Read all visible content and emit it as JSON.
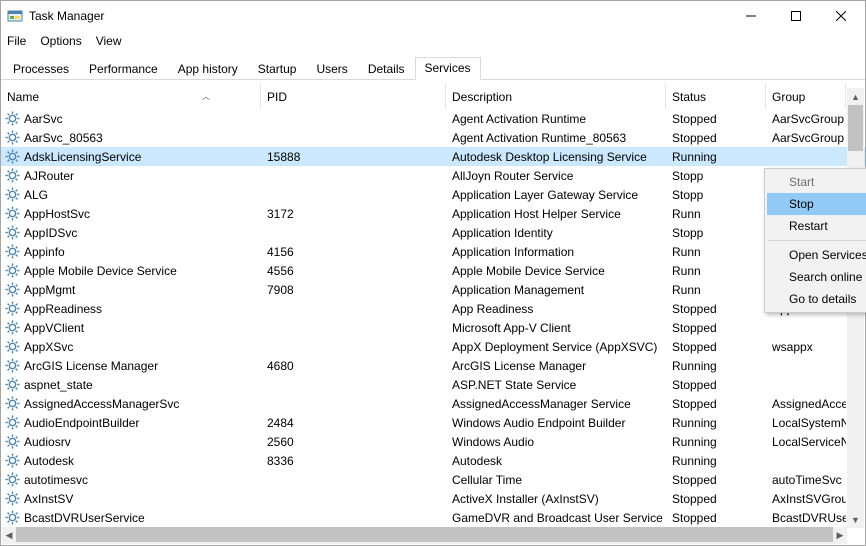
{
  "window": {
    "title": "Task Manager"
  },
  "menus": [
    "File",
    "Options",
    "View"
  ],
  "tabs": [
    {
      "label": "Processes"
    },
    {
      "label": "Performance"
    },
    {
      "label": "App history"
    },
    {
      "label": "Startup"
    },
    {
      "label": "Users"
    },
    {
      "label": "Details"
    },
    {
      "label": "Services",
      "active": true
    }
  ],
  "columns": [
    "Name",
    "PID",
    "Description",
    "Status",
    "Group"
  ],
  "rows": [
    {
      "name": "AarSvc",
      "pid": "",
      "desc": "Agent Activation Runtime",
      "status": "Stopped",
      "group": "AarSvcGroup"
    },
    {
      "name": "AarSvc_80563",
      "pid": "",
      "desc": "Agent Activation Runtime_80563",
      "status": "Stopped",
      "group": "AarSvcGroup"
    },
    {
      "name": "AdskLicensingService",
      "pid": "15888",
      "desc": "Autodesk Desktop Licensing Service",
      "status": "Running",
      "group": "",
      "selected": true
    },
    {
      "name": "AJRouter",
      "pid": "",
      "desc": "AllJoyn Router Service",
      "status": "Stopp",
      "group": ""
    },
    {
      "name": "ALG",
      "pid": "",
      "desc": "Application Layer Gateway Service",
      "status": "Stopp",
      "group": ""
    },
    {
      "name": "AppHostSvc",
      "pid": "3172",
      "desc": "Application Host Helper Service",
      "status": "Runn",
      "group": ""
    },
    {
      "name": "AppIDSvc",
      "pid": "",
      "desc": "Application Identity",
      "status": "Stopp",
      "group": ""
    },
    {
      "name": "Appinfo",
      "pid": "4156",
      "desc": "Application Information",
      "status": "Runn",
      "group": ""
    },
    {
      "name": "Apple Mobile Device Service",
      "pid": "4556",
      "desc": "Apple Mobile Device Service",
      "status": "Runn",
      "group": ""
    },
    {
      "name": "AppMgmt",
      "pid": "7908",
      "desc": "Application Management",
      "status": "Runn",
      "group": ""
    },
    {
      "name": "AppReadiness",
      "pid": "",
      "desc": "App Readiness",
      "status": "Stopped",
      "group": "AppReadiness"
    },
    {
      "name": "AppVClient",
      "pid": "",
      "desc": "Microsoft App-V Client",
      "status": "Stopped",
      "group": ""
    },
    {
      "name": "AppXSvc",
      "pid": "",
      "desc": "AppX Deployment Service (AppXSVC)",
      "status": "Stopped",
      "group": "wsappx"
    },
    {
      "name": "ArcGIS License Manager",
      "pid": "4680",
      "desc": "ArcGIS License Manager",
      "status": "Running",
      "group": ""
    },
    {
      "name": "aspnet_state",
      "pid": "",
      "desc": "ASP.NET State Service",
      "status": "Stopped",
      "group": ""
    },
    {
      "name": "AssignedAccessManagerSvc",
      "pid": "",
      "desc": "AssignedAccessManager Service",
      "status": "Stopped",
      "group": "AssignedAcce..."
    },
    {
      "name": "AudioEndpointBuilder",
      "pid": "2484",
      "desc": "Windows Audio Endpoint Builder",
      "status": "Running",
      "group": "LocalSystemN..."
    },
    {
      "name": "Audiosrv",
      "pid": "2560",
      "desc": "Windows Audio",
      "status": "Running",
      "group": "LocalServiceN..."
    },
    {
      "name": "Autodesk",
      "pid": "8336",
      "desc": "Autodesk",
      "status": "Running",
      "group": ""
    },
    {
      "name": "autotimesvc",
      "pid": "",
      "desc": "Cellular Time",
      "status": "Stopped",
      "group": "autoTimeSvc"
    },
    {
      "name": "AxInstSV",
      "pid": "",
      "desc": "ActiveX Installer (AxInstSV)",
      "status": "Stopped",
      "group": "AxInstSVGroup"
    },
    {
      "name": "BcastDVRUserService",
      "pid": "",
      "desc": "GameDVR and Broadcast User Service",
      "status": "Stopped",
      "group": "BcastDVRUser..."
    }
  ],
  "context_menu": {
    "items": [
      {
        "label": "Start",
        "disabled": true
      },
      {
        "label": "Stop",
        "highlighted": true
      },
      {
        "label": "Restart"
      },
      {
        "sep": true
      },
      {
        "label": "Open Services"
      },
      {
        "label": "Search online"
      },
      {
        "label": "Go to details"
      }
    ]
  }
}
